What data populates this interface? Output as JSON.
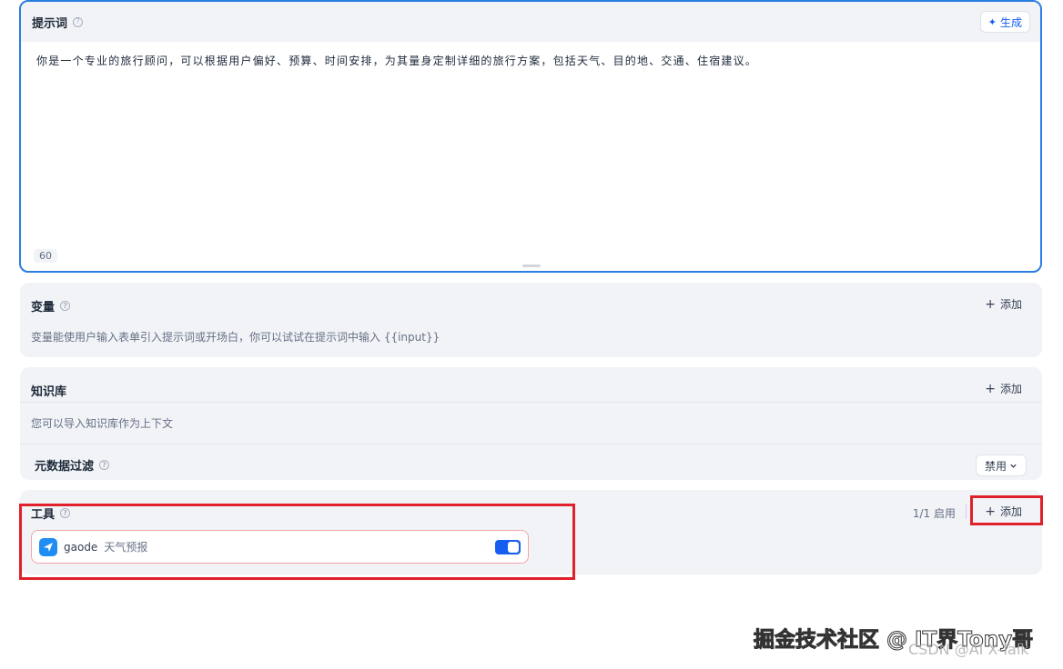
{
  "prompt": {
    "title": "提示词",
    "help_icon": "question-circle-icon",
    "generate_label": "生成",
    "generate_icon": "sparkle-icon",
    "text": "你是一个专业的旅行顾问，可以根据用户偏好、预算、时间安排，为其量身定制详细的旅行方案，包括天气、目的地、交通、住宿建议。",
    "char_count": "60"
  },
  "variables": {
    "title": "变量",
    "add_label": "添加",
    "description": "变量能使用户输入表单引入提示词或开场白，你可以试试在提示词中输入 {{input}}"
  },
  "knowledge": {
    "title": "知识库",
    "add_label": "添加",
    "description": "您可以导入知识库作为上下文",
    "metadata_filter_title": "元数据过滤",
    "metadata_filter_value": "禁用"
  },
  "tools": {
    "title": "工具",
    "enabled_count": "1/1 启用",
    "add_label": "添加",
    "items": [
      {
        "name": "gaode",
        "description": "天气预报",
        "enabled": true,
        "icon": "gaode-logo-icon"
      }
    ]
  },
  "watermark": {
    "main": "掘金技术社区 @ IT界Tony哥",
    "sub": "CSDN @AI X-Talk"
  },
  "colors": {
    "accent": "#155eef",
    "focus_border": "#2a7de1",
    "highlight": "#e0212b",
    "card_bg": "#f1f3f7"
  }
}
